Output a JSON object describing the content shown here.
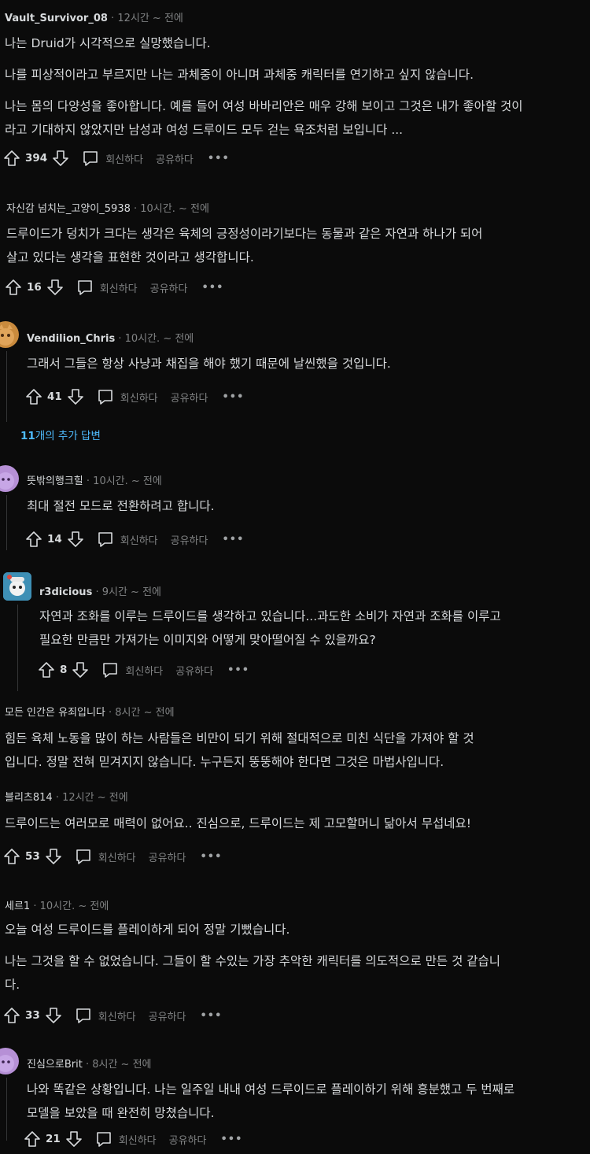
{
  "labels": {
    "reply": "회신하다",
    "share": "공유하다",
    "more": "•••"
  },
  "comments": [
    {
      "author": "Vault_Survivor_08",
      "time": "12시간 ~ 전에",
      "lines": [
        "나는 Druid가 시각적으로 실망했습니다.",
        "나를 피상적이라고 부르지만 나는 과체중이 아니며 과체중 캐릭터를 연기하고 싶지 않습니다.",
        "나는 몸의 다양성을 좋아합니다. 예를 들어 여성 바바리안은 매우 강해 보이고 그것은 내가 좋아할 것이",
        "라고 기대하지 않았지만 남성과 여성 드루이드 모두 걷는 욕조처럼 보입니다 ..."
      ],
      "votes": "394"
    },
    {
      "author": "자신감 넘치는_고양이_5938",
      "time": "10시간. ~ 전에",
      "lines": [
        "드루이드가 덩치가 크다는 생각은 육체의 긍정성이라기보다는 동물과 같은 자연과 하나가 되어",
        "살고 있다는 생각을 표현한 것이라고 생각합니다."
      ],
      "votes": "16"
    },
    {
      "author": "Vendilion_Chris",
      "time": "10시간. ~ 전에",
      "lines": [
        "그래서 그들은 항상 사냥과 채집을 해야 했기 때문에 날씬했을 것입니다."
      ],
      "votes": "41"
    },
    {
      "more_replies_count": "11",
      "more_replies_text": "개의 추가 답변"
    },
    {
      "author": "뜻밖의행크힐",
      "time": "10시간. ~ 전에",
      "lines": [
        "최대 절전 모드로 전환하려고 합니다."
      ],
      "votes": "14"
    },
    {
      "author": "r3dicious",
      "time": "9시간 ~ 전에",
      "lines": [
        "자연과 조화를 이루는 드루이드를 생각하고 있습니다...과도한 소비가 자연과 조화를 이루고",
        "필요한 만큼만 가져가는 이미지와 어떻게 맞아떨어질 수 있을까요?"
      ],
      "votes": "8"
    },
    {
      "author": "모든 인간은 유죄입니다",
      "time": "8시간 ~ 전에",
      "lines": [
        "힘든 육체 노동을 많이 하는 사람들은 비만이 되기 위해 절대적으로 미친 식단을 가져야 할 것",
        "입니다. 정말 전혀 믿겨지지 않습니다. 누구든지 뚱뚱해야 한다면 그것은 마법사입니다."
      ]
    },
    {
      "author": "블리츠814",
      "time": "12시간 ~ 전에",
      "lines": [
        "드루이드는 여러모로 매력이 없어요.. 진심으로, 드루이드는 제 고모할머니 닮아서 무섭네요!"
      ],
      "votes": "53"
    },
    {
      "author": "세르1",
      "time": "10시간. ~ 전에",
      "lines": [
        "오늘 여성 드루이드를 플레이하게 되어 정말 기뻤습니다.",
        "나는 그것을 할 수 없었습니다. 그들이 할 수있는 가장 추악한 캐릭터를 의도적으로 만든 것 같습니",
        "다."
      ],
      "votes": "33"
    },
    {
      "author": "진심으로Brit",
      "time": "8시간 ~ 전에",
      "lines": [
        "나와 똑같은 상황입니다. 나는 일주일 내내 여성 드루이드로 플레이하기 위해 흥분했고 두 번째로",
        "모델을 보았을 때 완전히 망쳤습니다."
      ],
      "votes": "21"
    }
  ],
  "colors": {
    "background": "#0b0b0b",
    "text": "#d7dadc",
    "meta": "#818384",
    "link": "#4fbcff",
    "thread": "#343536"
  }
}
